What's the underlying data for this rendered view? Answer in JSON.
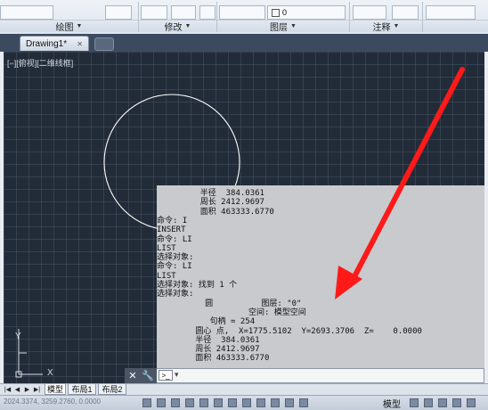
{
  "ribbon": {
    "panels": [
      {
        "label": "绘图",
        "arrow": "▼"
      },
      {
        "label": "修改",
        "arrow": "▼"
      },
      {
        "label": "图层",
        "arrow": "▼"
      },
      {
        "label": "注释",
        "arrow": "▼"
      }
    ],
    "layer_value": "0"
  },
  "document": {
    "tab_title": "Drawing1*",
    "close_glyph": "✕"
  },
  "viewport": {
    "label": "[−][俯视][二维线框]"
  },
  "command_history": {
    "lines": [
      "         半径  384.0361",
      "         周长 2412.9697",
      "         面积 463333.6770",
      "命令: I",
      "INSERT",
      "命令: LI",
      "LIST",
      "选择对象:",
      "命令: LI",
      "LIST",
      "选择对象: 找到 1 个",
      "选择对象:",
      "          圆          图层: \"0\"",
      "                   空间: 模型空间",
      "           句柄 = 254",
      "        圆心 点,  X=1775.5102  Y=2693.3706  Z=    0.0000",
      "        半径  384.0361",
      "        周长 2412.9697",
      "        面积 463333.6770"
    ]
  },
  "command_line": {
    "prompt_glyph": ">_",
    "arrow": "▾",
    "value": ""
  },
  "ucs": {
    "y_label": "Y",
    "x_label": "X"
  },
  "layout_tabs": {
    "nav": [
      "|◀",
      "◀",
      "▶",
      "▶|"
    ],
    "tabs": [
      "模型",
      "布局1",
      "布局2"
    ]
  },
  "status": {
    "coords": "2024.3374, 3259.2760, 0.0000",
    "model_label": "模型"
  },
  "colors": {
    "canvas_bg": "#222b38",
    "arrow_red": "#ff1a1a",
    "circle_stroke": "#ffffff",
    "cmd_panel_bg": "#c8cacd"
  }
}
